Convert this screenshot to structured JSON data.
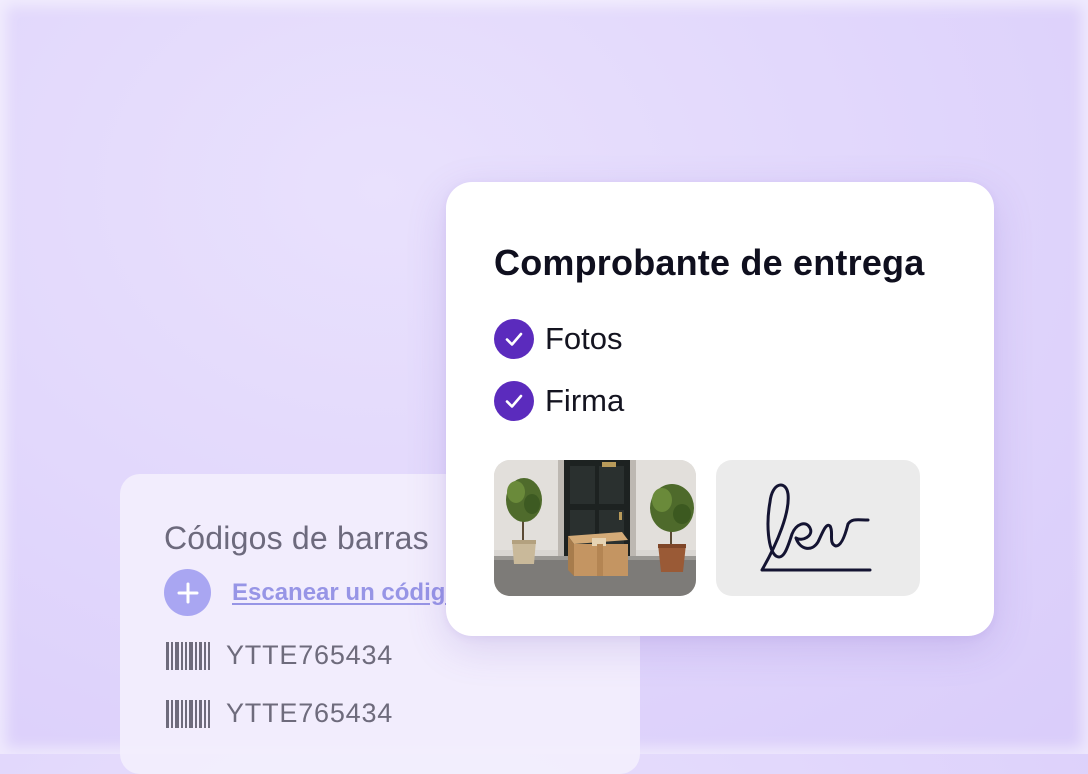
{
  "barcodes_card": {
    "title": "Códigos de barras",
    "scan_link": "Escanear un código",
    "add_icon": "plus-icon",
    "items": [
      {
        "icon": "barcode-icon",
        "code": "YTTE765434"
      },
      {
        "icon": "barcode-icon",
        "code": "YTTE765434"
      }
    ]
  },
  "proof_card": {
    "title": "Comprobante de entrega",
    "checklist": [
      {
        "icon": "check-circle-icon",
        "label": "Fotos",
        "checked": true
      },
      {
        "icon": "check-circle-icon",
        "label": "Firma",
        "checked": true
      }
    ],
    "photo_icon": "package-photo",
    "signature_icon": "signature-icon"
  },
  "colors": {
    "background": "#e2d8fc",
    "accent_purple": "#5b2bbd",
    "link_lavender": "#9795e6",
    "plus_button": "#a9a6f2",
    "signature_ink": "#141432"
  }
}
